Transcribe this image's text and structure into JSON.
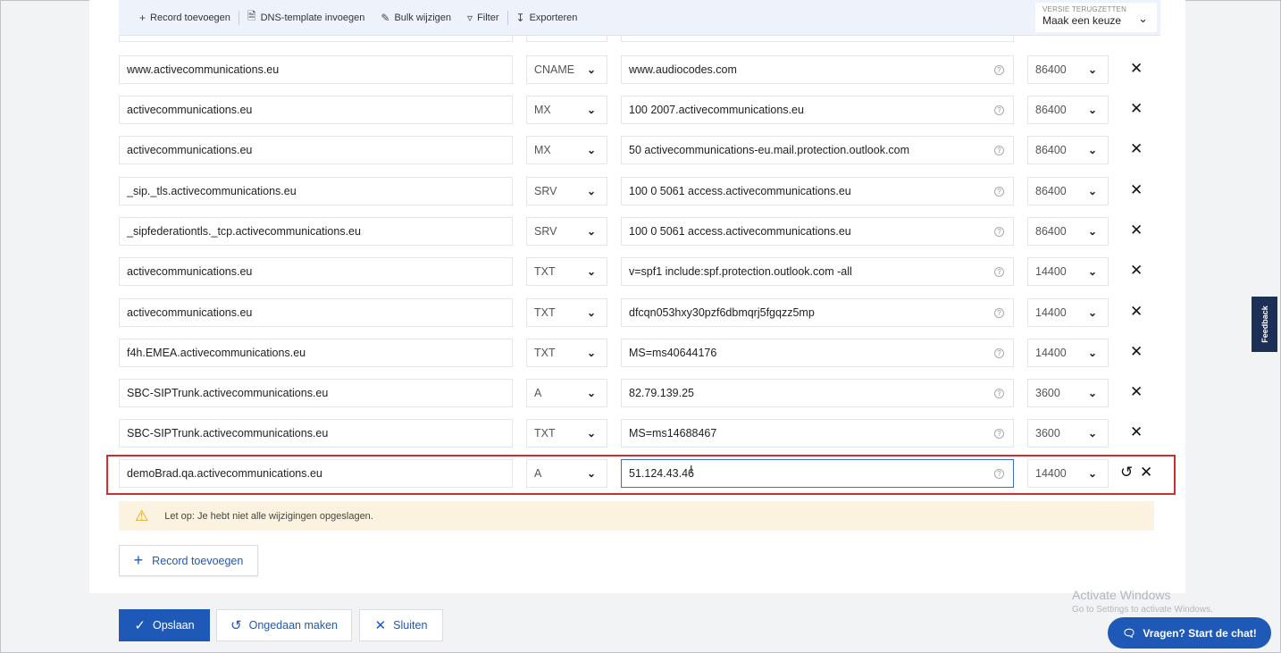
{
  "toolbar": {
    "add_record": "Record toevoegen",
    "dns_template": "DNS-template invoegen",
    "bulk_edit": "Bulk wijzigen",
    "filter": "Filter",
    "export": "Exporteren"
  },
  "version": {
    "label": "VERSIE TERUGZETTEN",
    "value": "Maak een keuze"
  },
  "records": [
    {
      "name": "www.activecommunications.eu",
      "type": "CNAME",
      "value": "www.audiocodes.com",
      "ttl": "86400"
    },
    {
      "name": "activecommunications.eu",
      "type": "MX",
      "value": "100 2007.activecommunications.eu",
      "ttl": "86400"
    },
    {
      "name": "activecommunications.eu",
      "type": "MX",
      "value": "50 activecommunications-eu.mail.protection.outlook.com",
      "ttl": "86400"
    },
    {
      "name": "_sip._tls.activecommunications.eu",
      "type": "SRV",
      "value": "100 0 5061 access.activecommunications.eu",
      "ttl": "86400"
    },
    {
      "name": "_sipfederationtls._tcp.activecommunications.eu",
      "type": "SRV",
      "value": "100 0 5061 access.activecommunications.eu",
      "ttl": "86400"
    },
    {
      "name": "activecommunications.eu",
      "type": "TXT",
      "value": "v=spf1 include:spf.protection.outlook.com -all",
      "ttl": "14400"
    },
    {
      "name": "activecommunications.eu",
      "type": "TXT",
      "value": "dfcqn053hxy30pzf6dbmqrj5fgqzz5mp",
      "ttl": "14400"
    },
    {
      "name": "f4h.EMEA.activecommunications.eu",
      "type": "TXT",
      "value": "MS=ms40644176",
      "ttl": "14400"
    },
    {
      "name": "SBC-SIPTrunk.activecommunications.eu",
      "type": "A",
      "value": "82.79.139.25",
      "ttl": "3600"
    },
    {
      "name": "SBC-SIPTrunk.activecommunications.eu",
      "type": "TXT",
      "value": "MS=ms14688467",
      "ttl": "3600"
    },
    {
      "name": "demoBrad.qa.activecommunications.eu",
      "type": "A",
      "value": "51.124.43.46",
      "ttl": "14400"
    }
  ],
  "warning": "Let op: Je hebt niet alle wijzigingen opgeslagen.",
  "add_record_button": "Record toevoegen",
  "footer": {
    "save": "Opslaan",
    "undo": "Ongedaan maken",
    "close": "Sluiten"
  },
  "feedback": "Feedback",
  "watermark": {
    "title": "Activate Windows",
    "subtitle": "Go to Settings to activate Windows."
  },
  "chat": "Vragen? Start de chat!",
  "colors": {
    "primary": "#1f59b8",
    "highlight_border": "#d42a32",
    "warning_bg": "#fbf3df",
    "feedback_bg": "#1c2f57"
  }
}
